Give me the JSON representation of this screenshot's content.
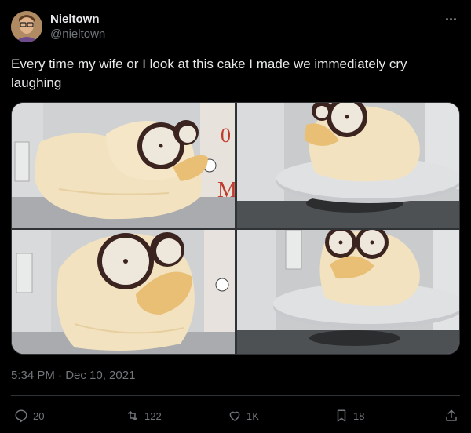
{
  "author": {
    "display_name": "Nieltown",
    "handle": "@nieltown"
  },
  "tweet": {
    "text": "Every time my wife or I look at this cake I made we immediately cry laughing",
    "timestamp": "5:34 PM · Dec 10, 2021"
  },
  "stats": {
    "replies": "20",
    "retweets": "122",
    "likes": "1K",
    "bookmarks": "18"
  },
  "colors": {
    "background": "#000000",
    "text": "#e7e9ea",
    "secondary": "#71767b",
    "border": "#2f3336"
  },
  "icons": [
    "more-icon",
    "reply-icon",
    "retweet-icon",
    "like-icon",
    "bookmark-icon",
    "share-icon"
  ]
}
